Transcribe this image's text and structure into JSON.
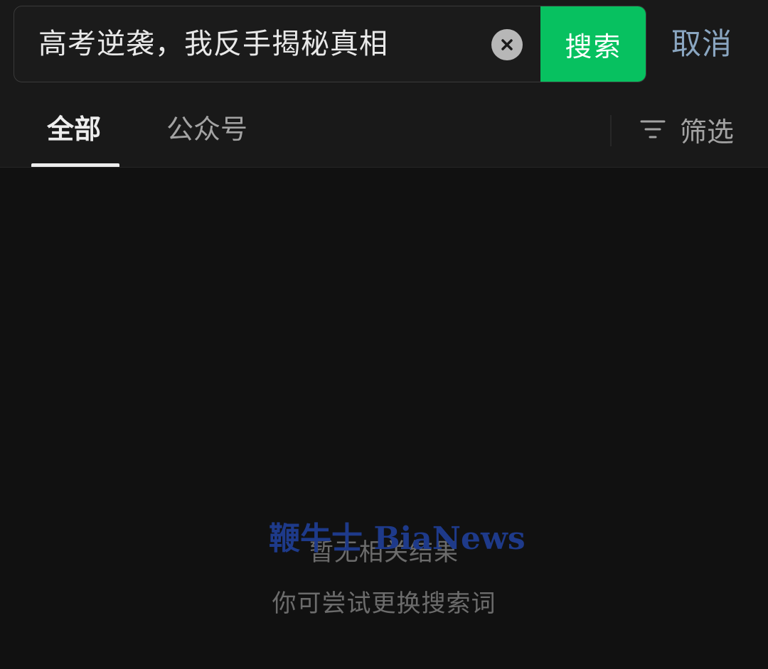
{
  "search": {
    "query": "高考逆袭，我反手揭秘真相",
    "button_label": "搜索",
    "cancel_label": "取消",
    "clear_icon": "close-icon"
  },
  "tabs": [
    {
      "label": "全部",
      "active": true
    },
    {
      "label": "公众号",
      "active": false
    }
  ],
  "filter": {
    "label": "筛选",
    "icon": "filter-icon"
  },
  "empty_state": {
    "title": "暂无相关结果",
    "hint": "你可尝试更换搜索词"
  },
  "watermark": "鞭牛士 BiaNews",
  "colors": {
    "accent": "#07c160",
    "cancel": "#8aa6c1",
    "background": "#111111",
    "watermark": "#1e3a8a"
  }
}
